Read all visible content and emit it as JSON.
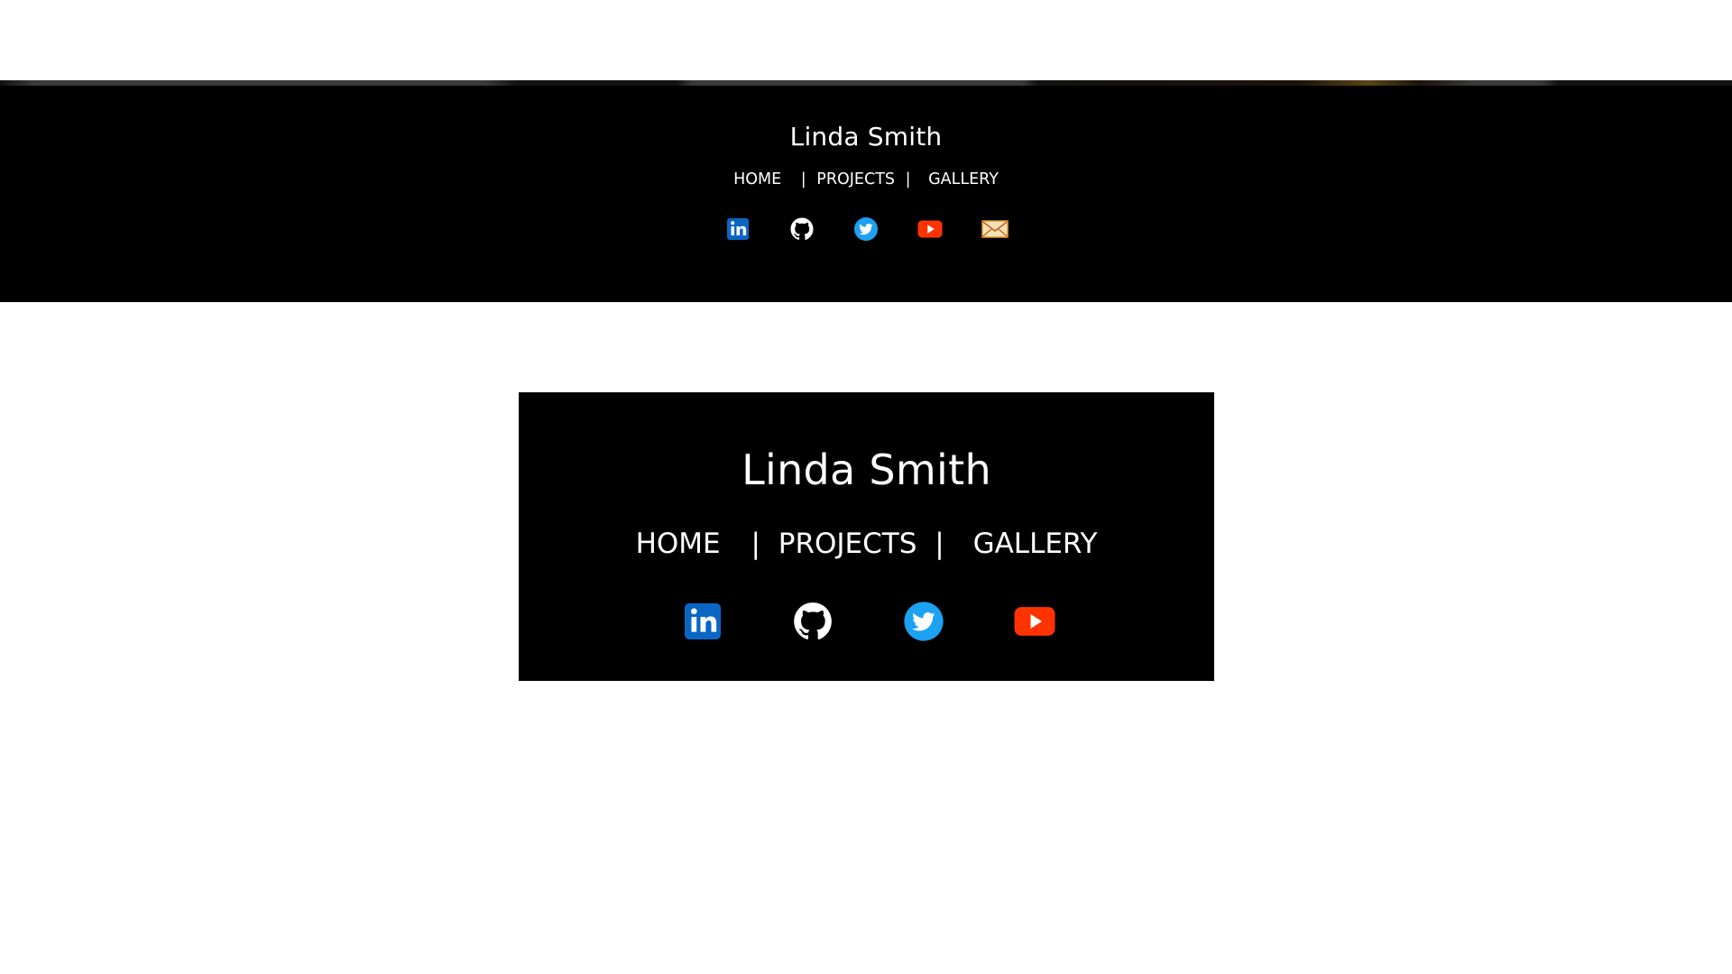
{
  "header": {
    "name": "Linda Smith",
    "nav": {
      "home": "HOME",
      "sep1": "|",
      "projects": "PROJECTS",
      "sep2": "|",
      "gallery": "GALLERY"
    },
    "icons": [
      "linkedin-icon",
      "github-icon",
      "twitter-icon",
      "youtube-icon",
      "email-icon"
    ]
  },
  "card": {
    "name": "Linda Smith",
    "nav": {
      "home": "HOME",
      "sep1": "|",
      "projects": "PROJECTS",
      "sep2": "|",
      "gallery": "GALLERY"
    },
    "icons": [
      "linkedin-icon",
      "github-icon",
      "twitter-icon",
      "youtube-icon"
    ]
  },
  "colors": {
    "background": "#ffffff",
    "header_bg": "#000000",
    "text": "#ffffff",
    "linkedin": "#0a66c2",
    "twitter": "#1da1f2",
    "youtube": "#ff3300",
    "email": "#f0b030"
  }
}
